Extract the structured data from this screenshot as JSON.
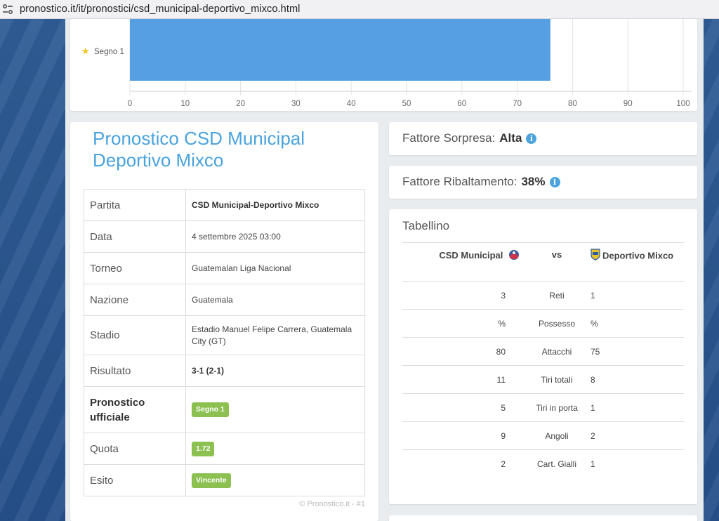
{
  "browser": {
    "url": "pronostico.it/it/pronostici/csd_municipal-deportivo_mixco.html",
    "site_icon": "tune-icon"
  },
  "chart_data": {
    "type": "bar",
    "orientation": "horizontal",
    "categories": [
      "Segno 1"
    ],
    "values": [
      76
    ],
    "xlim": [
      0,
      100
    ],
    "xticks": [
      "0",
      "10",
      "20",
      "30",
      "40",
      "50",
      "60",
      "70",
      "80",
      "90",
      "100"
    ],
    "grid": true,
    "bar_color": "#569fe2"
  },
  "pronostico": {
    "title": "Pronostico CSD Municipal Deportivo Mixco",
    "rows": [
      {
        "label": "Partita",
        "value": "CSD Municipal-Deportivo Mixco"
      },
      {
        "label": "Data",
        "value": "4 settembre 2025 03:00"
      },
      {
        "label": "Torneo",
        "value": "Guatemalan Liga Nacional"
      },
      {
        "label": "Nazione",
        "value": "Guatemala"
      },
      {
        "label": "Stadio",
        "value": "Estadio Manuel Felipe Carrera, Guatemala City (GT)"
      },
      {
        "label": "Risultato",
        "value": "3-1 (2-1)"
      },
      {
        "label": "Pronostico ufficiale",
        "value": "Segno 1"
      },
      {
        "label": "Quota",
        "value": "1.72"
      },
      {
        "label": "Esito",
        "value": "Vincente"
      }
    ],
    "footer": "© Pronostico.it - #1"
  },
  "fattore_sorpresa": {
    "label": "Fattore Sorpresa:",
    "value": "Alta"
  },
  "fattore_ribaltamento": {
    "label": "Fattore Ribaltamento:",
    "value": "38%"
  },
  "tabellino": {
    "title": "Tabellino",
    "home": "CSD Municipal",
    "vs": "vs",
    "away": "Deportivo Mixco",
    "stats": [
      {
        "home": "3",
        "label": "Reti",
        "away": "1"
      },
      {
        "home": "%",
        "label": "Possesso",
        "away": "%"
      },
      {
        "home": "80",
        "label": "Attacchi",
        "away": "75"
      },
      {
        "home": "11",
        "label": "Tiri totali",
        "away": "8"
      },
      {
        "home": "5",
        "label": "Tiri in porta",
        "away": "1"
      },
      {
        "home": "9",
        "label": "Angoli",
        "away": "2"
      },
      {
        "home": "2",
        "label": "Cart. Gialli",
        "away": "1"
      }
    ]
  },
  "colors": {
    "accent": "#4aa3df",
    "badge_green": "#8cc152"
  }
}
